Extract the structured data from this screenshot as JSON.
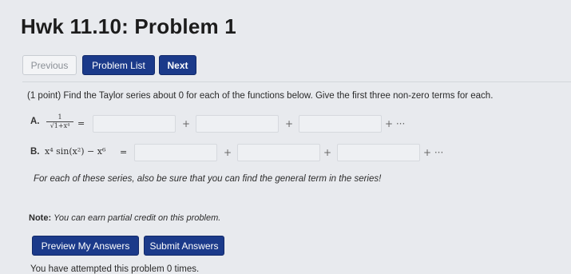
{
  "title": "Hwk 11.10: Problem 1",
  "nav": {
    "previous": "Previous",
    "problem_list": "Problem List",
    "next": "Next"
  },
  "problem": {
    "statement": "(1 point) Find the Taylor series about 0 for each of the functions below. Give the first three non-zero terms for each.",
    "part_a": {
      "label": "A.",
      "numerator": "1",
      "denominator": "√1+x⁴",
      "equals": "=",
      "plus": "+",
      "plus_ellipsis": "+ ···",
      "answers": [
        "",
        "",
        ""
      ]
    },
    "part_b": {
      "label": "B.",
      "expression": "x⁴ sin(x²) − x⁶",
      "equals": "=",
      "plus": "+",
      "plus_ellipsis": "+ ···",
      "answers": [
        "",
        "",
        ""
      ]
    },
    "italic_note": "For each of these series, also be sure that you can find the general term in the series!"
  },
  "note": {
    "label": "Note:",
    "text": "You can earn partial credit on this problem."
  },
  "actions": {
    "preview": "Preview My Answers",
    "submit": "Submit Answers"
  },
  "attempts_text": "You have attempted this problem 0 times.",
  "colors": {
    "primary_button": "#1b3a8a",
    "background": "#e8eaee",
    "input_bg": "#eef0f3"
  }
}
